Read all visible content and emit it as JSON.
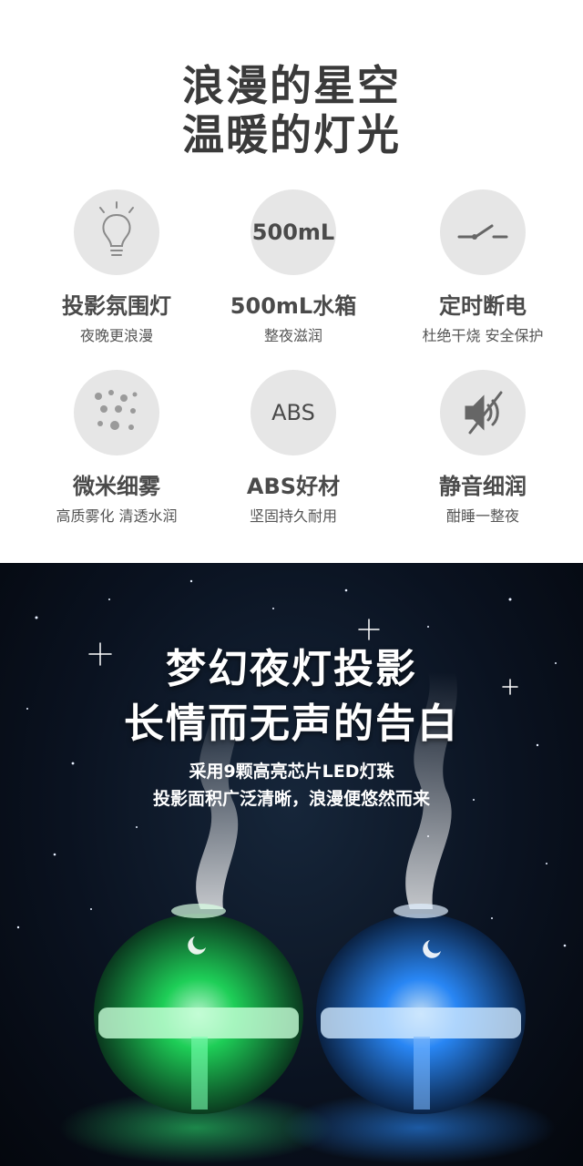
{
  "headline": {
    "line1": "浪漫的星空",
    "line2": "温暖的灯光"
  },
  "features": [
    {
      "icon": "lightbulb-icon",
      "badge": "",
      "title": "投影氛围灯",
      "subtitle": "夜晚更浪漫"
    },
    {
      "icon": "capacity-icon",
      "badge": "500mL",
      "title": "500mL水箱",
      "subtitle": "整夜滋润"
    },
    {
      "icon": "switch-icon",
      "badge": "",
      "title": "定时断电",
      "subtitle": "杜绝干烧 安全保护"
    },
    {
      "icon": "mist-dots-icon",
      "badge": "",
      "title": "微米细雾",
      "subtitle": "高质雾化 清透水润"
    },
    {
      "icon": "abs-icon",
      "badge": "ABS",
      "title": "ABS好材",
      "subtitle": "坚固持久耐用"
    },
    {
      "icon": "mute-speaker-icon",
      "badge": "",
      "title": "静音细润",
      "subtitle": "酣睡一整夜"
    }
  ],
  "banner": {
    "title1": "梦幻夜灯投影",
    "title2": "长情而无声的告白",
    "desc1": "采用9颗高亮芯片LED灯珠",
    "desc2": "投影面积广泛清晰，浪漫便悠然而来"
  },
  "colors": {
    "icon_bg": "#e6e6e6",
    "text": "#4a4a4a",
    "night_bg": "#0a1220",
    "green_glow": "#1fd85a",
    "blue_glow": "#2a8cff"
  }
}
